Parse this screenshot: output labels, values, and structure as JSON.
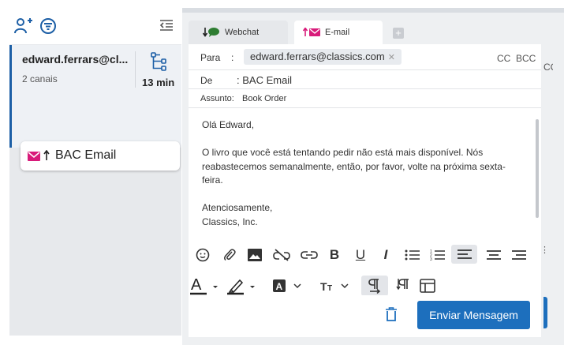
{
  "sidebar": {
    "toolbar": {
      "add_contact_icon": "person-plus-icon",
      "filter_icon": "filter-icon",
      "collapse_icon": "collapse-list-icon"
    },
    "conversation": {
      "name": "edward.ferrars@cl...",
      "channels": "2 canais",
      "time": "13 min",
      "icon": "branch-tree-icon"
    },
    "email_card": {
      "label": "BAC Email",
      "icon": "email-icon"
    }
  },
  "tabs": [
    {
      "label": "Webchat",
      "icon": "chat-icon"
    },
    {
      "label": "E-mail",
      "icon": "email-icon"
    }
  ],
  "compose": {
    "to_label": "Para",
    "to_sep": ":",
    "to_value": "edward.ferrars@classics.com",
    "cc": "CC",
    "bcc": "BCC",
    "cut_cc": "CC",
    "from_label": "De",
    "from_value": ": BAC Email",
    "subject_label": "Assunto:",
    "subject_value": "Book Order",
    "body": {
      "greeting": "Olá Edward,",
      "p1": "O livro que você está tentando pedir não está mais disponível. Nós reabastecemos semanalmente, então, por favor, volte na próxima sexta-feira.",
      "closing": "Atenciosamente,",
      "signature": "Classics, Inc."
    }
  },
  "footer": {
    "send_label": "Enviar Mensagem"
  },
  "colors": {
    "accent": "#1d6fbd",
    "email_pink": "#d81b7a",
    "chat_green": "#2e7d32",
    "sidebar_bg": "#e7e9ec"
  }
}
